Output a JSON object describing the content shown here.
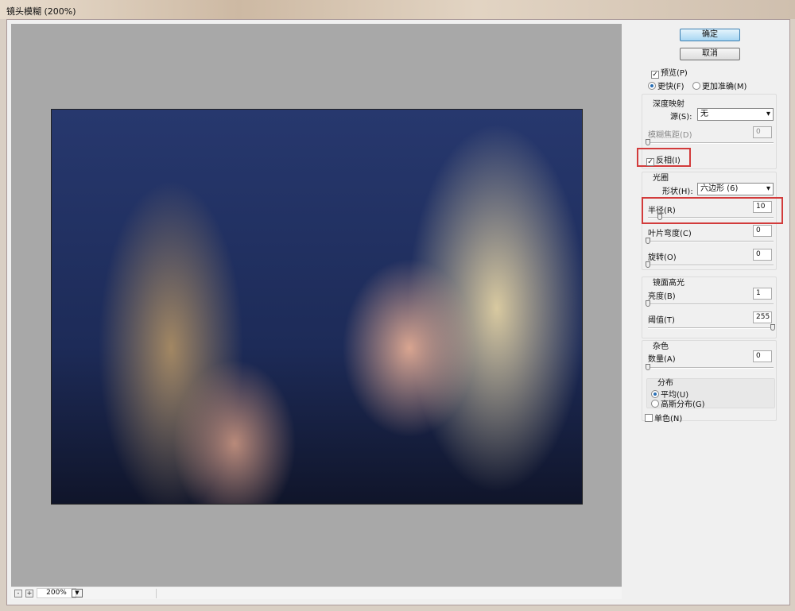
{
  "window": {
    "title": "镜头模糊 (200%)"
  },
  "buttons": {
    "ok": "确定",
    "cancel": "取消"
  },
  "preview": {
    "label": "预览(P)",
    "checked": true,
    "faster": "更快(F)",
    "more_accurate": "更加准确(M)",
    "selected": "faster"
  },
  "depth_map": {
    "title": "深度映射",
    "source_label": "源(S):",
    "source_value": "无",
    "blur_focal_label": "模糊焦距(D)",
    "blur_focal_value": "0",
    "blur_focal_slider": 0,
    "invert_label": "反相(I)",
    "invert_checked": true
  },
  "iris": {
    "title": "光圈",
    "shape_label": "形状(H):",
    "shape_value": "六边形 (6)",
    "radius_label": "半径(R)",
    "radius_value": "10",
    "blade_label": "叶片弯度(C)",
    "blade_value": "0",
    "rotation_label": "旋转(O)",
    "rotation_value": "0"
  },
  "specular": {
    "title": "镜面高光",
    "brightness_label": "亮度(B)",
    "brightness_value": "1",
    "threshold_label": "阈值(T)",
    "threshold_value": "255"
  },
  "noise": {
    "title": "杂色",
    "amount_label": "数量(A)",
    "amount_value": "0",
    "distribution_title": "分布",
    "uniform": "平均(U)",
    "gaussian": "高斯分布(G)",
    "selected": "uniform",
    "mono_label": "单色(N)",
    "mono_checked": false
  },
  "statusbar": {
    "zoom": "200%",
    "zoom_out": "-",
    "zoom_in": "+"
  },
  "colors": {
    "highlight": "#d23b3b",
    "canvas": "#a8a8a8"
  }
}
